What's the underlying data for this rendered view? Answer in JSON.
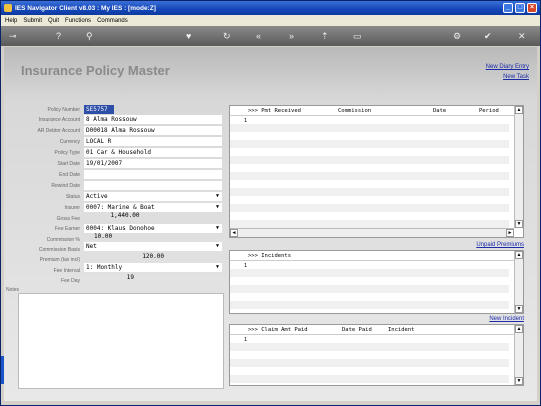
{
  "window": {
    "title": "IES Navigator Client v8.03 : My IES :      [mode:Z]"
  },
  "menu": [
    "Help",
    "Submit",
    "Quit",
    "Functions",
    "Commands"
  ],
  "toolbar_icons": [
    "key-icon",
    "help-icon",
    "search-icon",
    "heart-icon",
    "refresh-icon",
    "rewind-icon",
    "forward-icon",
    "upload-icon",
    "bookmark-icon",
    "settings-icon",
    "check-icon",
    "close-icon"
  ],
  "page": {
    "title": "Insurance Policy Master",
    "new_diary": "New Diary Entry",
    "new_task": "New Task"
  },
  "fields": {
    "policy_number": {
      "label": "Policy Number",
      "value": "SE5757"
    },
    "insurance_account": {
      "label": "Insurance Account",
      "value": "8 Alma Rossouw"
    },
    "ar_debtor_account": {
      "label": "AR Debtor Account",
      "value": "D00018 Alma Rossouw"
    },
    "currency": {
      "label": "Currency",
      "value": "LOCAL R"
    },
    "policy_type": {
      "label": "Policy Type",
      "value": "01 Car & Household"
    },
    "start_date": {
      "label": "Start Date",
      "value": "19/01/2007"
    },
    "end_date": {
      "label": "End Date",
      "value": ""
    },
    "rewind_date": {
      "label": "Rewind Date",
      "value": ""
    },
    "status": {
      "label": "Status",
      "value": "Active"
    },
    "insurer": {
      "label": "Insurer",
      "value": "0007: Marine & Boat"
    },
    "gross_fee": {
      "label": "Gross Fee",
      "value": "1,440.00"
    },
    "fee_earner": {
      "label": "Fee Earner",
      "value": "0004: Klaus Donohoe"
    },
    "commission_pct": {
      "label": "Commission %",
      "value": "10.00"
    },
    "commission_basis": {
      "label": "Commission Basis",
      "value": "Net"
    },
    "premium": {
      "label": "Premium (tax incl)",
      "value": "120.00"
    },
    "fee_interval": {
      "label": "Fee Interval",
      "value": "1: Monthly"
    },
    "fee_day": {
      "label": "Fee Day",
      "value": "19"
    },
    "notes": {
      "label": "Notes"
    }
  },
  "premiums_panel": {
    "columns": [
      ">>> Pmt Received",
      "Commission",
      "Date",
      "Period"
    ],
    "row_number": "1",
    "link": "Unpaid Premiums"
  },
  "incidents_panel": {
    "columns": [
      ">>> Incidents"
    ],
    "row_number": "1",
    "link": "New Incident"
  },
  "claims_panel": {
    "columns": [
      ">>> Claim Amt Paid",
      "Date Paid",
      "Incident"
    ],
    "row_number": "1"
  }
}
